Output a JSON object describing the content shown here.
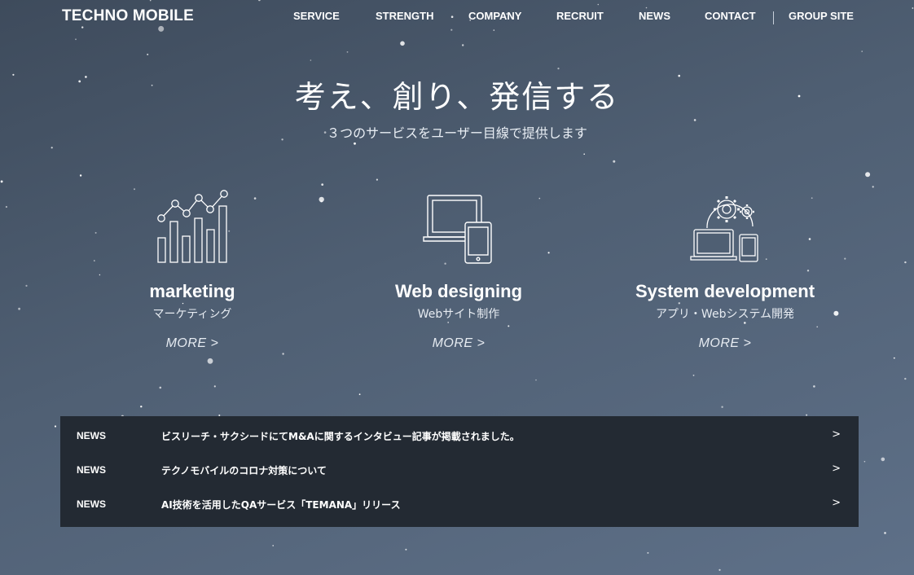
{
  "header": {
    "logo": "TECHNO MOBILE",
    "nav": [
      {
        "label": "SERVICE"
      },
      {
        "label": "STRENGTH"
      },
      {
        "label": "COMPANY"
      },
      {
        "label": "RECRUIT"
      },
      {
        "label": "NEWS"
      },
      {
        "label": "CONTACT"
      },
      {
        "label": "GROUP SITE"
      }
    ]
  },
  "hero": {
    "title": "考え、創り、発信する",
    "subtitle": "３つのサービスをユーザー目線で提供します"
  },
  "services": [
    {
      "title": "marketing",
      "subtitle": "マーケティング",
      "more": "MORE >",
      "icon": "bar-chart-icon"
    },
    {
      "title": "Web designing",
      "subtitle": "Webサイト制作",
      "more": "MORE >",
      "icon": "devices-icon"
    },
    {
      "title": "System development",
      "subtitle": "アプリ・Webシステム開発",
      "more": "MORE >",
      "icon": "gears-devices-icon"
    }
  ],
  "news": [
    {
      "tag": "NEWS",
      "text": "ビスリーチ・サクシードにてM&Aに関するインタビュー記事が掲載されました。",
      "arrow": ">"
    },
    {
      "tag": "NEWS",
      "text": "テクノモバイルのコロナ対策について",
      "arrow": ">"
    },
    {
      "tag": "NEWS",
      "text": "AI技術を活用したQAサービス「TEMANA」リリース",
      "arrow": ">"
    }
  ],
  "colors": {
    "background_top": "#3e4b5c",
    "background_bottom": "#5e7088",
    "news_panel": "#232a33",
    "text": "#ffffff"
  }
}
